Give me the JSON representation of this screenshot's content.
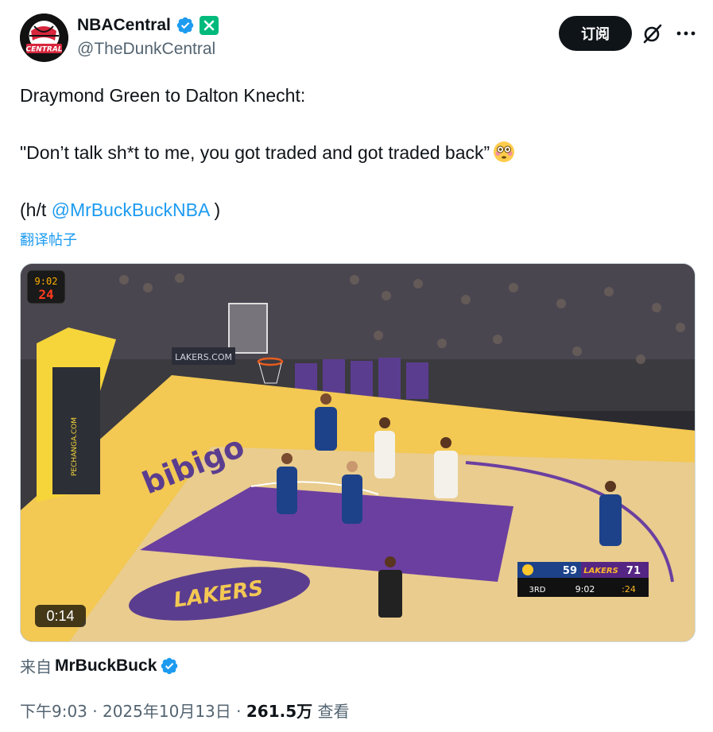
{
  "author": {
    "display_name": "NBACentral",
    "handle": "@TheDunkCentral",
    "avatar_text": "CENTRAL"
  },
  "actions": {
    "subscribe_label": "订阅"
  },
  "tweet": {
    "line1": "Draymond Green to Dalton Knecht:",
    "line2": "\"Don’t talk sh*t to me, you got traded and got traded back”",
    "line3_prefix": "(h/t ",
    "line3_mention": "@MrBuckBuckNBA",
    "line3_suffix": " )",
    "translate_label": "翻译帖子"
  },
  "media": {
    "duration": "0:14",
    "shot_clock_time": "9:02",
    "shot_clock_seconds": "24",
    "scoreboard": {
      "home_score": "59",
      "away_team": "LAKERS",
      "away_score": "71",
      "period": "3RD",
      "game_clock": "9:02",
      "shot_clock": ":24"
    },
    "court_text": "bibigo",
    "arena_sign": "LAKERS.COM"
  },
  "source": {
    "prefix": "来自",
    "name": "MrBuckBuck"
  },
  "meta": {
    "time_date": "下午9:03 · 2025年10月13日 · ",
    "views": "261.5万",
    "views_label": " 查看"
  },
  "colors": {
    "link": "#1d9bf0",
    "verified": "#1d9bf0",
    "text": "#0f1419",
    "secondary": "#536471"
  }
}
